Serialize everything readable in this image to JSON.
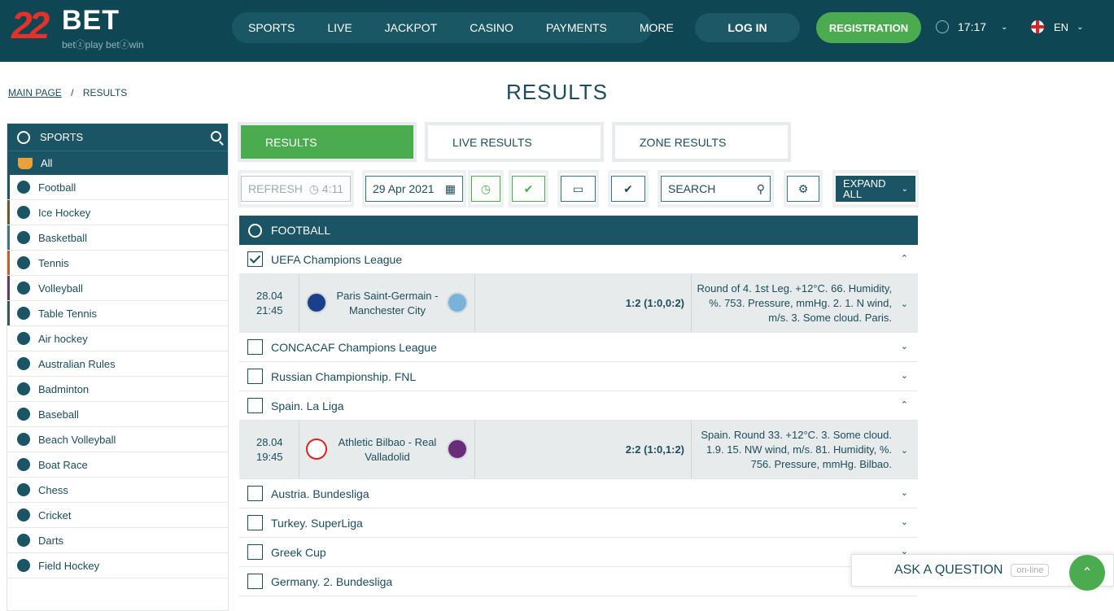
{
  "header": {
    "logo_num": "22",
    "logo_text": "BET",
    "logo_tag": "betⓩplay betⓩwin",
    "nav": [
      "SPORTS",
      "LIVE",
      "JACKPOT",
      "CASINO",
      "PAYMENTS",
      "MORE"
    ],
    "login": "LOG IN",
    "register": "REGISTRATION",
    "time": "17:17",
    "lang": "EN"
  },
  "breadcrumb": {
    "home": "MAIN PAGE",
    "sep": "/",
    "current": "RESULTS"
  },
  "title": "RESULTS",
  "sidebar": {
    "head": "SPORTS",
    "all": "All",
    "items": [
      {
        "label": "Football",
        "color": "#1b5464"
      },
      {
        "label": "Ice Hockey",
        "color": "#6b5a2b"
      },
      {
        "label": "Basketball",
        "color": "#3d7383"
      },
      {
        "label": "Tennis",
        "color": "#b9652e"
      },
      {
        "label": "Volleyball",
        "color": "#5b3c6b"
      },
      {
        "label": "Table Tennis",
        "color": "#2f5d4a"
      },
      {
        "label": "Air hockey",
        "color": ""
      },
      {
        "label": "Australian Rules",
        "color": ""
      },
      {
        "label": "Badminton",
        "color": ""
      },
      {
        "label": "Baseball",
        "color": ""
      },
      {
        "label": "Beach Volleyball",
        "color": ""
      },
      {
        "label": "Boat Race",
        "color": ""
      },
      {
        "label": "Chess",
        "color": ""
      },
      {
        "label": "Cricket",
        "color": ""
      },
      {
        "label": "Darts",
        "color": ""
      },
      {
        "label": "Field Hockey",
        "color": ""
      }
    ]
  },
  "tabs": [
    "RESULTS",
    "LIVE RESULTS",
    "ZONE RESULTS"
  ],
  "toolbar": {
    "refresh": "REFRESH",
    "timer": "4:11",
    "date": "29 Apr 2021",
    "search": "SEARCH",
    "expand": "EXPAND ALL"
  },
  "section": "FOOTBALL",
  "leagues": [
    {
      "name": "UEFA Champions League",
      "checked": true,
      "open": true,
      "match": {
        "date": "28.04",
        "time": "21:45",
        "teams": "Paris Saint-Germain - Manchester City",
        "score": "1:2 (1:0,0:2)",
        "info": "Round of 4. 1st Leg. +12°C. 66. Humidity, %. 753. Pressure, mmHg. 2. 1. N wind, m/s. 3. Some cloud. Paris."
      }
    },
    {
      "name": "CONCACAF Champions League",
      "checked": false,
      "open": false
    },
    {
      "name": "Russian Championship. FNL",
      "checked": false,
      "open": false
    },
    {
      "name": "Spain. La Liga",
      "checked": false,
      "open": true,
      "match": {
        "date": "28.04",
        "time": "19:45",
        "teams": "Athletic Bilbao - Real Valladolid",
        "score": "2:2 (1:0,1:2)",
        "info": "Spain. Round 33. +12°C. 3. Some cloud. 1.9. 15. NW wind, m/s. 81. Humidity, %. 756. Pressure, mmHg. Bilbao."
      }
    },
    {
      "name": "Austria. Bundesliga",
      "checked": false,
      "open": false
    },
    {
      "name": "Turkey. SuperLiga",
      "checked": false,
      "open": false
    },
    {
      "name": "Greek Cup",
      "checked": false,
      "open": false
    },
    {
      "name": "Germany. 2. Bundesliga",
      "checked": false,
      "open": false
    }
  ],
  "ask": {
    "label": "ASK A QUESTION",
    "status": "on-line"
  },
  "colors": {
    "brand": "#0f4653",
    "accent": "#4bac4f",
    "logo_red": "#e4322b"
  }
}
